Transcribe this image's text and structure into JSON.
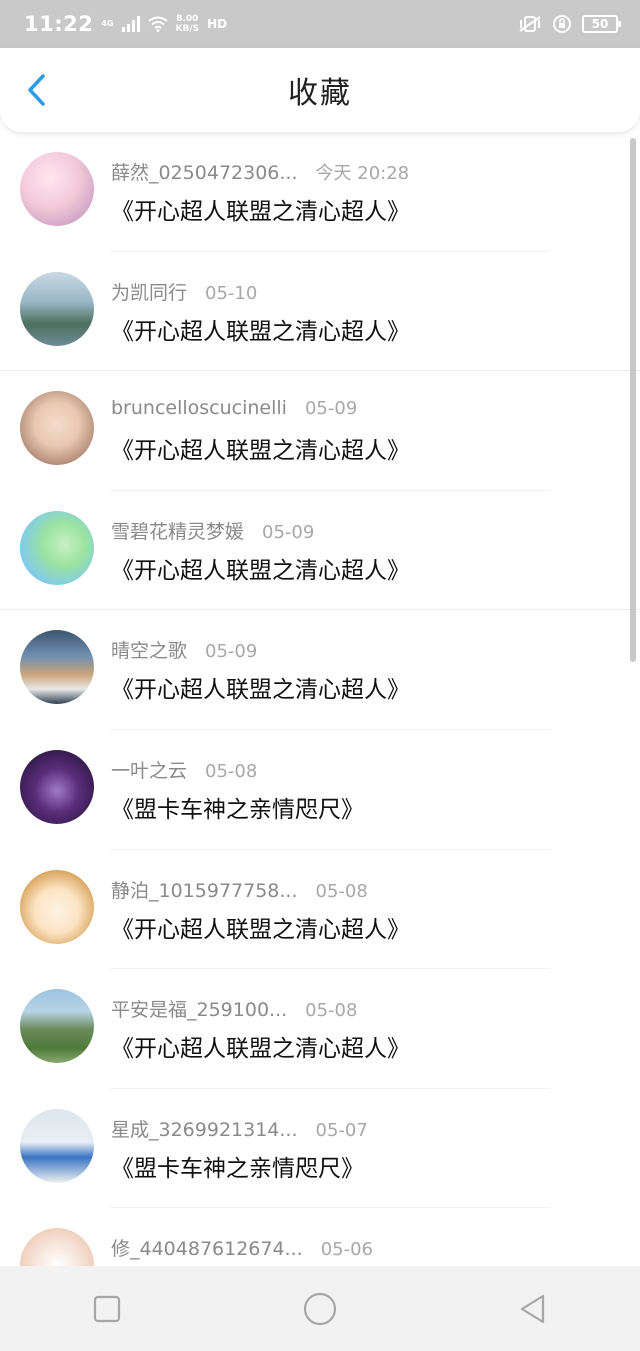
{
  "status_bar": {
    "time": "11:22",
    "network": "4G",
    "speed_value": "8.00",
    "speed_unit": "KB/S",
    "hd": "HD",
    "battery": "50"
  },
  "header": {
    "title": "收藏",
    "back_icon": "chevron-left-icon"
  },
  "favorites": [
    {
      "user": "薛然_0250472306...",
      "date": "今天 20:28",
      "title": "《开心超人联盟之清心超人》",
      "avatar_colors": [
        "#f3c9d9",
        "#b88ab8"
      ]
    },
    {
      "user": "为凯同行",
      "date": "05-10",
      "title": "《开心超人联盟之清心超人》",
      "avatar_colors": [
        "#9bb6c7",
        "#4c6f5e"
      ]
    },
    {
      "user": "bruncelloscucinelli",
      "date": "05-09",
      "title": "《开心超人联盟之清心超人》",
      "avatar_colors": [
        "#e9c7b1",
        "#8a5e4c"
      ]
    },
    {
      "user": "雪碧花精灵梦媛",
      "date": "05-09",
      "title": "《开心超人联盟之清心超人》",
      "avatar_colors": [
        "#7fc9ef",
        "#9be3a0"
      ]
    },
    {
      "user": "晴空之歌",
      "date": "05-09",
      "title": "《开心超人联盟之清心超人》",
      "avatar_colors": [
        "#6e8fb0",
        "#c9a47a"
      ]
    },
    {
      "user": "一叶之云",
      "date": "05-08",
      "title": "《盟卡车神之亲情咫尺》",
      "avatar_colors": [
        "#5a2d7a",
        "#1a0d2e"
      ]
    },
    {
      "user": "静泊_1015977758...",
      "date": "05-08",
      "title": "《开心超人联盟之清心超人》",
      "avatar_colors": [
        "#fbe4c4",
        "#c48a3a"
      ]
    },
    {
      "user": "平安是福_259100...",
      "date": "05-08",
      "title": "《开心超人联盟之清心超人》",
      "avatar_colors": [
        "#9cc3e0",
        "#4f7a3a"
      ]
    },
    {
      "user": "星成_3269921314...",
      "date": "05-07",
      "title": "《盟卡车神之亲情咫尺》",
      "avatar_colors": [
        "#dde6ee",
        "#3a74c4"
      ]
    },
    {
      "user": "修_440487612674...",
      "date": "05-06",
      "title": "",
      "avatar_colors": [
        "#f6e3d8",
        "#e6b9a2"
      ]
    }
  ],
  "nav": {
    "square_icon": "recent-apps-icon",
    "circle_icon": "home-icon",
    "triangle_icon": "back-icon"
  }
}
